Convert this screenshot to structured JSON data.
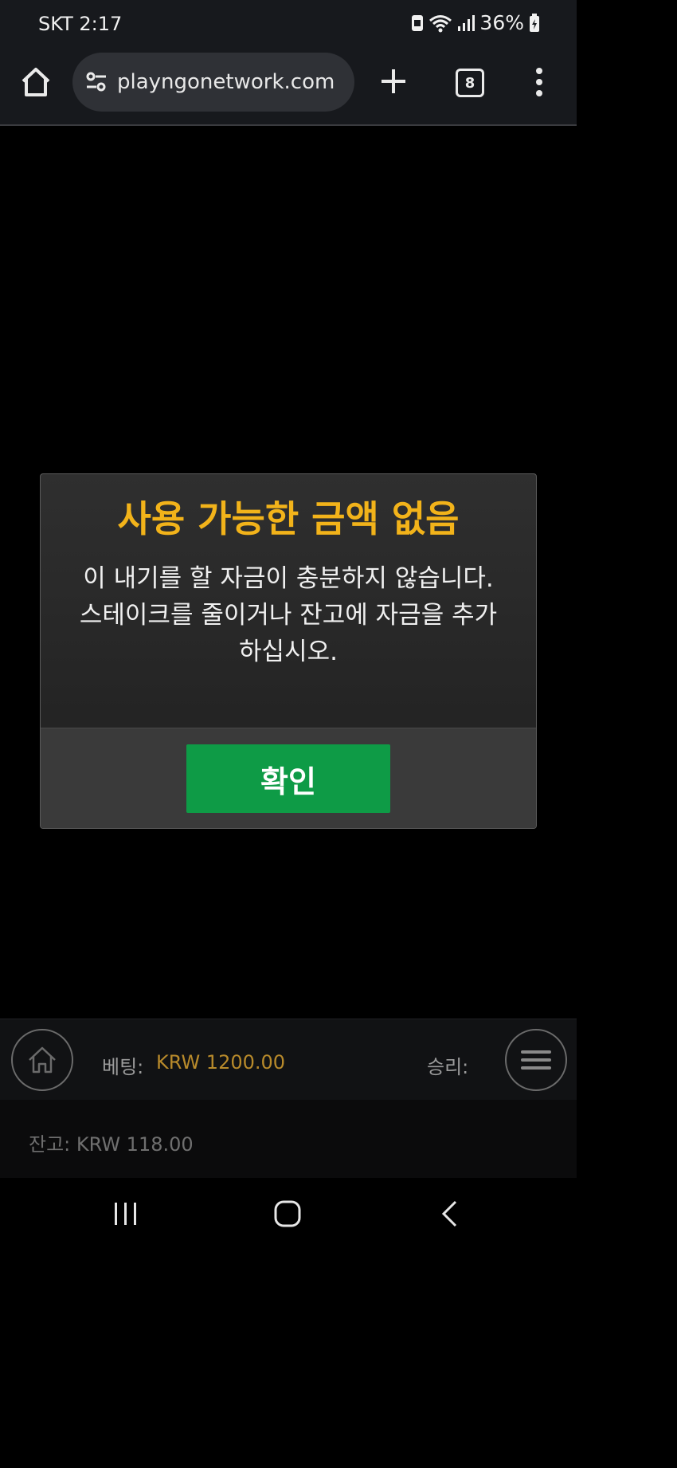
{
  "status_bar": {
    "carrier_time": "SKT 2:17",
    "battery": "36%",
    "icons": [
      "photo-icon",
      "wifi-icon",
      "signal-icon",
      "battery-icon"
    ]
  },
  "browser": {
    "url": "playngonetwork.com",
    "tab_count": "8",
    "icons": [
      "home-icon",
      "site-settings-icon",
      "new-tab-icon",
      "tabs-icon",
      "more-menu-icon"
    ]
  },
  "dialog": {
    "title": "사용 가능한 금액 없음",
    "message_line1": "이 내기를 할 자금이 충분하지 않습니다.",
    "message_line2": "스테이크를 줄이거나 잔고에 자금을 추가",
    "message_line3": "하십시오.",
    "confirm_label": "확인"
  },
  "game_bar": {
    "bet_label": "베팅:",
    "bet_value": "KRW 1200.00",
    "win_label": "승리:",
    "balance": "잔고: KRW 118.00"
  },
  "colors": {
    "title_yellow": "#f2b31a",
    "confirm_green": "#0e9b46",
    "bet_gold": "#b88a2b"
  }
}
